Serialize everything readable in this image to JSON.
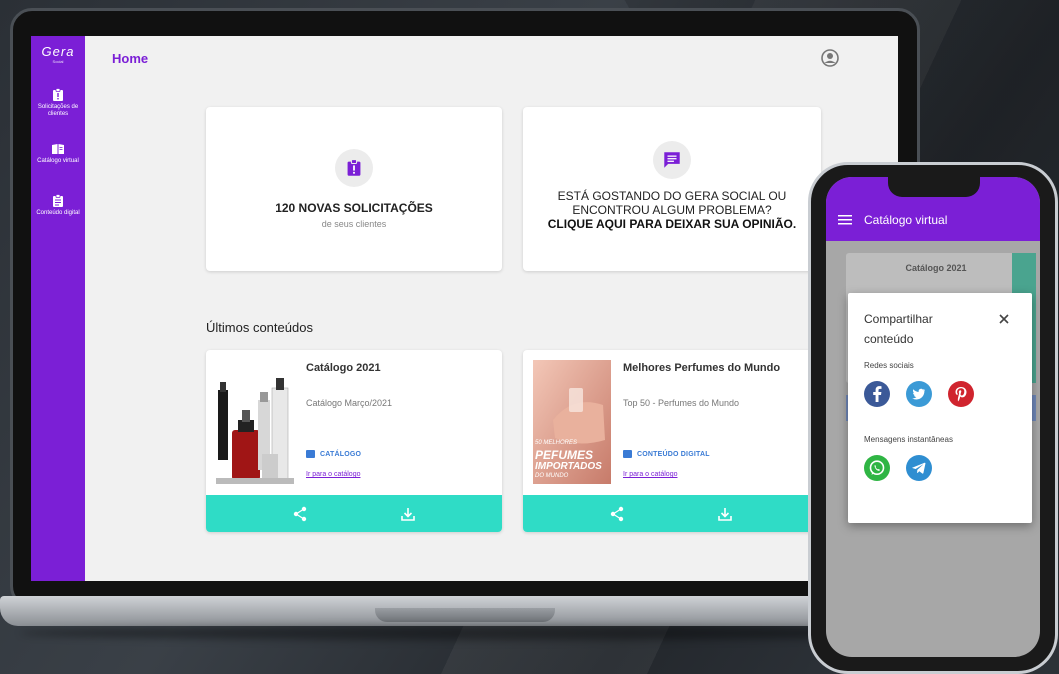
{
  "app": {
    "logo": "Gera",
    "logo_sub": "Social"
  },
  "sidebar": {
    "items": [
      {
        "label": "Solicitações de clientes",
        "icon": "clipboard-alert-icon"
      },
      {
        "label": "Catálogo virtual",
        "icon": "book-icon"
      },
      {
        "label": "Conteúdo digital",
        "icon": "clipboard-list-icon"
      }
    ]
  },
  "header": {
    "title": "Home",
    "user_icon": "account-circle-icon"
  },
  "cards": {
    "requests": {
      "title": "120 NOVAS SOLICITAÇÕES",
      "subtitle": "de seus clientes",
      "icon": "clipboard-alert-icon"
    },
    "feedback": {
      "line1": "ESTÁ GOSTANDO DO GERA SOCIAL OU",
      "line2": "ENCONTROU ALGUM PROBLEMA?",
      "cta": "CLIQUE AQUI PARA DEIXAR SUA OPINIÃO.",
      "icon": "message-icon"
    }
  },
  "latest": {
    "title": "Últimos conteúdos",
    "items": [
      {
        "title": "Catálogo 2021",
        "subtitle": "Catálogo Março/2021",
        "tag": "CATÁLOGO",
        "link": "Ir para o catálogo"
      },
      {
        "title": "Melhores Perfumes do Mundo",
        "subtitle": "Top 50 - Perfumes do Mundo",
        "tag": "CONTEÚDO DIGITAL",
        "link": "Ir para o catálogo",
        "thumb_text": {
          "l1": "50 MELHORES",
          "l2": "PEFUMES",
          "l3": "IMPORTADOS",
          "l4": "DO MUNDO"
        }
      }
    ]
  },
  "phone": {
    "title": "Catálogo virtual",
    "bg_card_title": "Catálogo 2021",
    "modal": {
      "title": "Compartilhar conteúdo",
      "social_label": "Redes sociais",
      "messaging_label": "Mensagens instantâneas",
      "social_icons": [
        "facebook-icon",
        "twitter-icon",
        "pinterest-icon"
      ],
      "messaging_icons": [
        "whatsapp-icon",
        "telegram-icon"
      ]
    }
  },
  "colors": {
    "primary": "#7b1fd6",
    "teal": "#2fdcc6",
    "link_blue": "#3a7bd5"
  }
}
